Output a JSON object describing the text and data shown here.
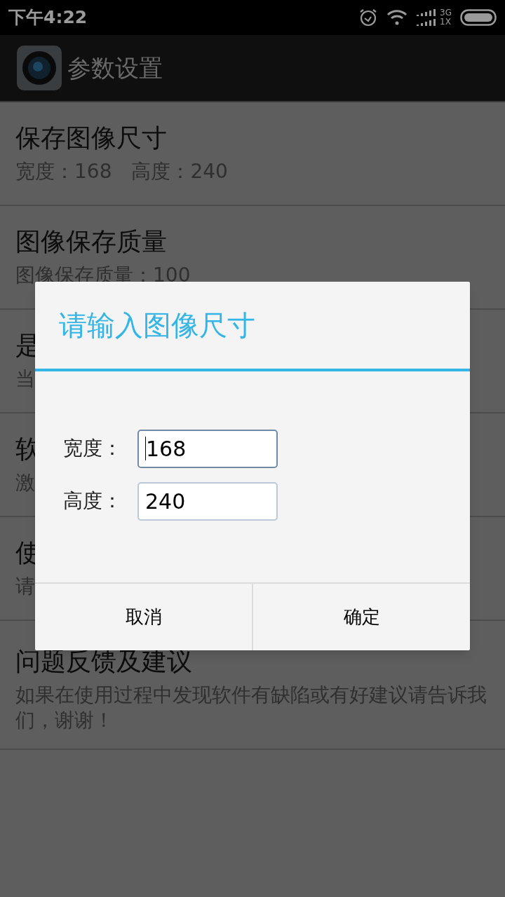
{
  "status_bar": {
    "time": "下午4:22",
    "network": [
      "3G",
      "1X"
    ]
  },
  "app_bar": {
    "title": "参数设置"
  },
  "settings": [
    {
      "title": "保存图像尺寸",
      "summary": "宽度：168　高度：240"
    },
    {
      "title": "图像保存质量",
      "summary": "图像保存质量：100"
    },
    {
      "title": "是",
      "summary": "当"
    },
    {
      "title": "软",
      "summary": "激"
    },
    {
      "title": "使",
      "summary": "请"
    },
    {
      "title": "问题反馈及建议",
      "summary": "如果在使用过程中发现软件有缺陷或有好建议请告诉我们，谢谢！"
    }
  ],
  "dialog": {
    "title": "请输入图像尺寸",
    "fields": [
      {
        "label": "宽度：",
        "value": "168",
        "focused": true
      },
      {
        "label": "高度：",
        "value": "240",
        "focused": false
      }
    ],
    "buttons": [
      "取消",
      "确定"
    ]
  }
}
